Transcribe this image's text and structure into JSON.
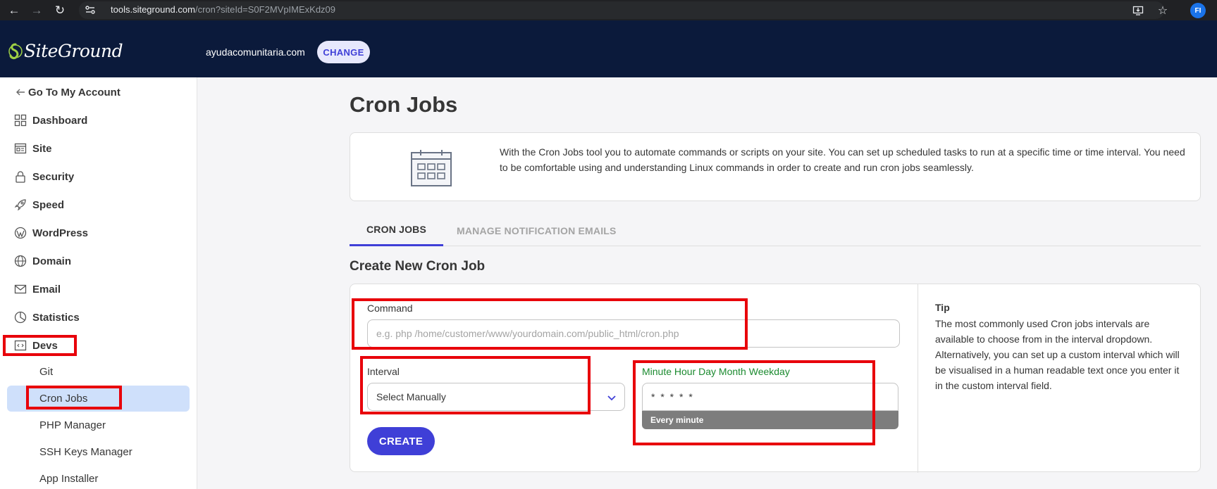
{
  "browser": {
    "url_host": "tools.siteground.com",
    "url_path": "/cron?siteId=S0F2MVpIMExKdz09",
    "profile_initials": "FI"
  },
  "header": {
    "logo_text": "SiteGround",
    "domain": "ayudacomunitaria.com",
    "change_label": "CHANGE"
  },
  "sidebar": {
    "back_label": "Go To My Account",
    "items": [
      {
        "label": "Dashboard",
        "icon": "grid-icon"
      },
      {
        "label": "Site",
        "icon": "browser-window-icon"
      },
      {
        "label": "Security",
        "icon": "lock-icon"
      },
      {
        "label": "Speed",
        "icon": "rocket-icon"
      },
      {
        "label": "WordPress",
        "icon": "wordpress-icon"
      },
      {
        "label": "Domain",
        "icon": "globe-icon"
      },
      {
        "label": "Email",
        "icon": "envelope-icon"
      },
      {
        "label": "Statistics",
        "icon": "pie-chart-icon"
      },
      {
        "label": "Devs",
        "icon": "code-icon"
      }
    ],
    "devs_subitems": [
      {
        "label": "Git"
      },
      {
        "label": "Cron Jobs"
      },
      {
        "label": "PHP Manager"
      },
      {
        "label": "SSH Keys Manager"
      },
      {
        "label": "App Installer"
      }
    ]
  },
  "main": {
    "title": "Cron Jobs",
    "info_text": "With the Cron Jobs tool you to automate commands or scripts on your site. You can set up scheduled tasks to run at a specific time or time interval. You need to be comfortable using and understanding Linux commands in order to create and run cron jobs seamlessly.",
    "tabs": [
      {
        "label": "CRON JOBS",
        "active": true
      },
      {
        "label": "MANAGE NOTIFICATION EMAILS",
        "active": false
      }
    ],
    "section_title": "Create New Cron Job",
    "form": {
      "command_label": "Command",
      "command_placeholder": "e.g. php /home/customer/www/yourdomain.com/public_html/cron.php",
      "interval_label": "Interval",
      "interval_value": "Select Manually",
      "cron_label": "Minute Hour Day Month Weekday",
      "cron_value": "* * * * *",
      "cron_hint": "Every minute",
      "create_label": "CREATE"
    },
    "tip": {
      "title": "Tip",
      "text": "The most commonly used Cron jobs intervals are available to choose from in the interval dropdown. Alternatively, you can set up a custom interval which will be visualised in a human readable text once you enter it in the custom interval field."
    }
  },
  "colors": {
    "header_bg": "#0b1a3b",
    "accent": "#3f3fd7",
    "active_sidebar_bg": "#cfe0fb",
    "annotation_red": "#e8000a",
    "cron_label_green": "#1b8a2f"
  }
}
